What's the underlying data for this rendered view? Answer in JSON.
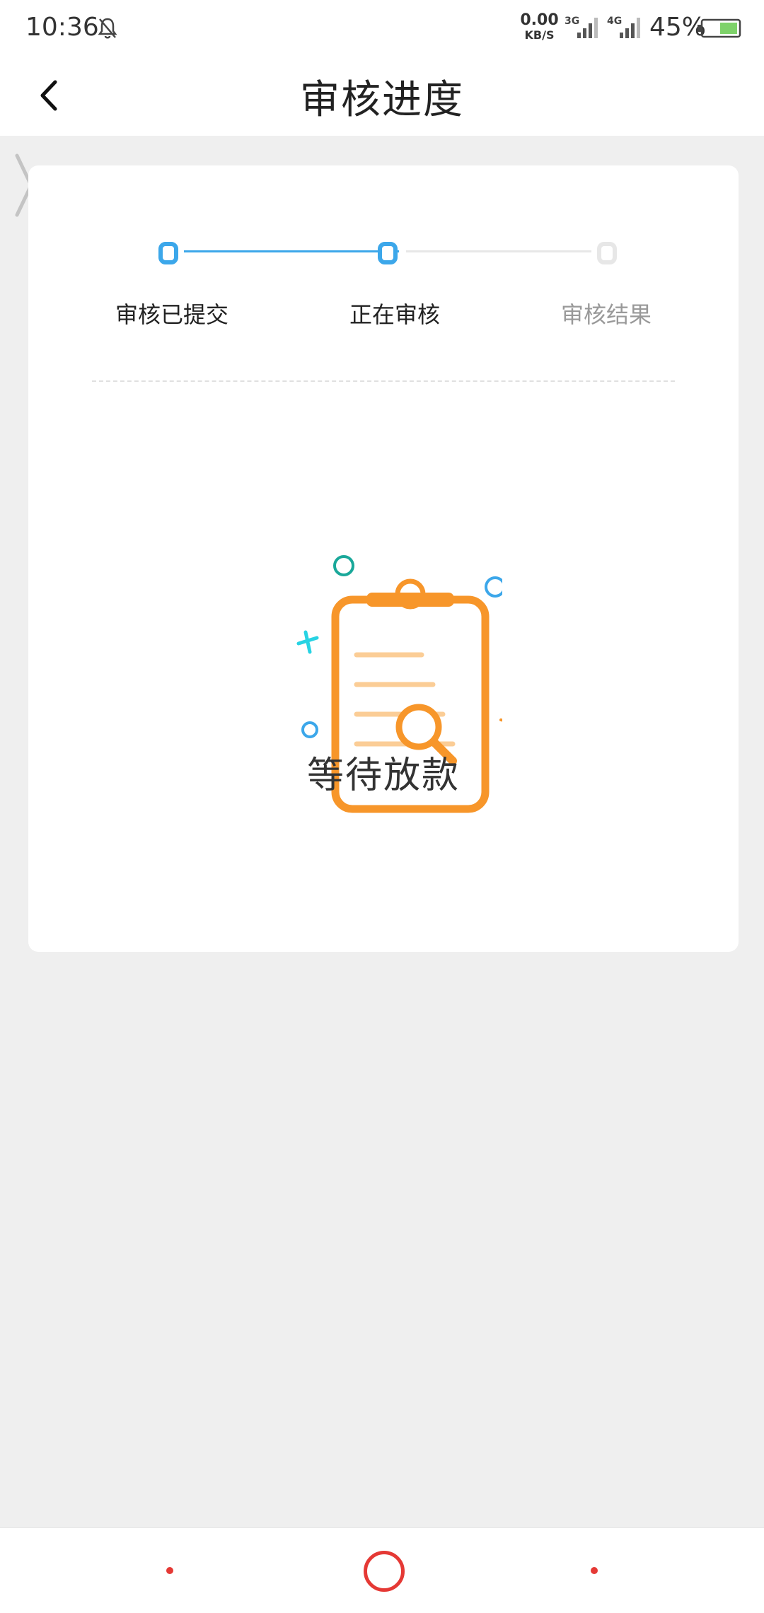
{
  "status_bar": {
    "time": "10:36",
    "net_speed_value": "0.00",
    "net_speed_unit": "KB/S",
    "sim1_type": "3G",
    "sim2_type": "4G",
    "battery_percent": "45%"
  },
  "nav": {
    "title": "审核进度"
  },
  "steps": [
    {
      "label": "审核已提交",
      "state": "done"
    },
    {
      "label": "正在审核",
      "state": "active"
    },
    {
      "label": "审核结果",
      "state": "pending"
    }
  ],
  "status": {
    "text": "等待放款"
  },
  "colors": {
    "accent": "#3ca7ea",
    "pending": "#e7e7e7",
    "illustration": "#f7962a",
    "home_button": "#e53935",
    "battery_fill": "#7ed26a"
  },
  "icons": {
    "back": "chevron-left-icon",
    "side": "chevron-right-icon",
    "bell": "bell-muted-icon",
    "illustration": "clipboard-search-icon"
  }
}
